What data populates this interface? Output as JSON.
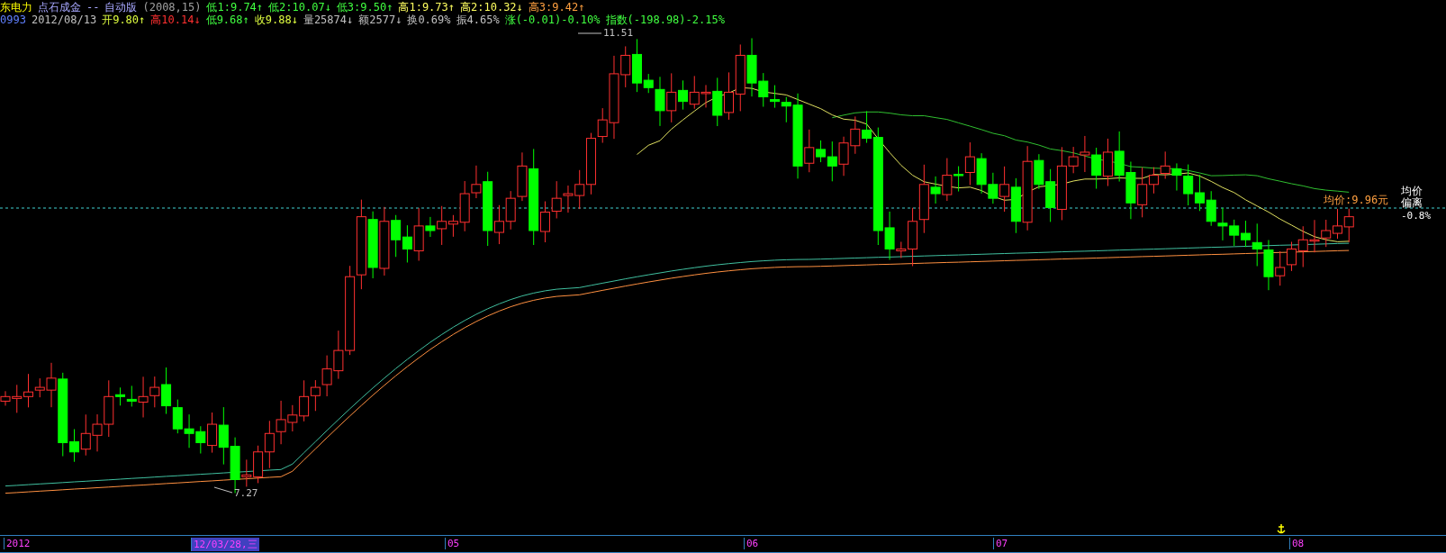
{
  "header": {
    "row_1": [
      {
        "text": "东电力",
        "kind": "name"
      },
      {
        "text": "点石成金",
        "kind": "title"
      },
      {
        "text": "--",
        "kind": "title"
      },
      {
        "text": "自动版",
        "kind": "title"
      },
      {
        "text": "(2008,15)",
        "kind": "param"
      },
      {
        "text": "低1:9.74↑",
        "kind": "low"
      },
      {
        "text": "低2:10.07↓",
        "kind": "low"
      },
      {
        "text": "低3:9.50↑",
        "kind": "low"
      },
      {
        "text": "高1:9.73↑",
        "kind": "high"
      },
      {
        "text": "高2:10.32↓",
        "kind": "high"
      },
      {
        "text": "高3:9.42↑",
        "kind": "extra"
      }
    ],
    "row_2": [
      {
        "text": "0993",
        "kind": "code"
      },
      {
        "text": "2012/08/13",
        "kind": "stat"
      },
      {
        "text": "开9.80↑",
        "kind": "price"
      },
      {
        "text": "高10.14↓",
        "kind": "peak"
      },
      {
        "text": "低9.68↑",
        "kind": "low"
      },
      {
        "text": "收9.88↓",
        "kind": "price"
      },
      {
        "text": "量25874↓",
        "kind": "stat"
      },
      {
        "text": "额2577↓",
        "kind": "stat"
      },
      {
        "text": "换0.69%",
        "kind": "stat"
      },
      {
        "text": "振4.65%",
        "kind": "stat"
      },
      {
        "text": "涨(-0.01)-0.10%",
        "kind": "low"
      },
      {
        "text": "指数(-198.98)-2.15%",
        "kind": "low"
      }
    ]
  },
  "chart": {
    "high_label": "11.51",
    "low_label": "7.27",
    "average_price_label": "均价:9.96元",
    "deviation_title": "均价偏离",
    "deviation_value": "-0.8%"
  },
  "time_axis": {
    "labels": [
      {
        "text": "2012",
        "selected": false
      },
      {
        "text": "12/03/28,三",
        "selected": true
      },
      {
        "text": "05",
        "selected": false
      },
      {
        "text": "06",
        "selected": false
      },
      {
        "text": "07",
        "selected": false
      },
      {
        "text": "08",
        "selected": false
      }
    ]
  }
}
